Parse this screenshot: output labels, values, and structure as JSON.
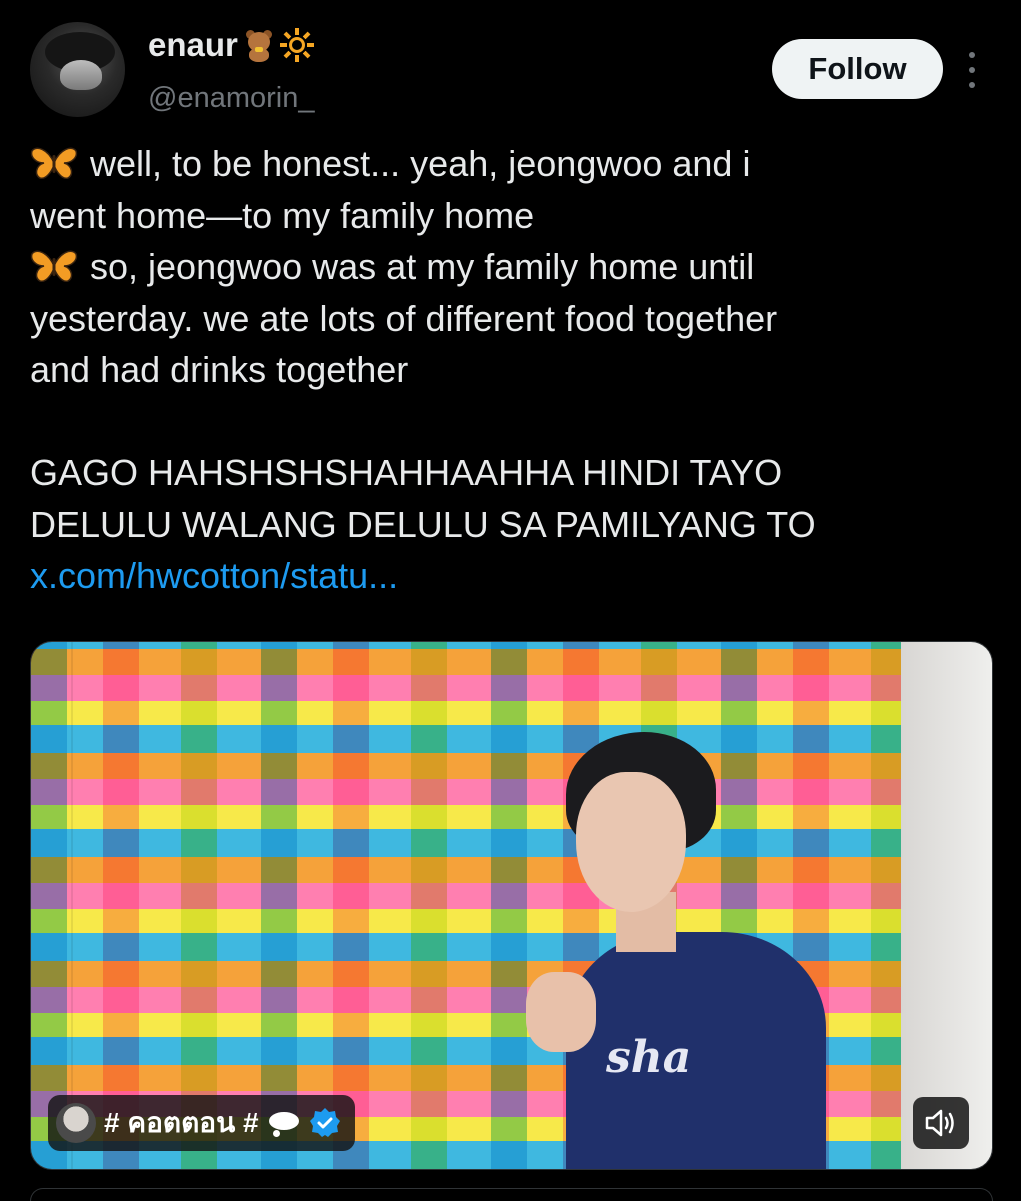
{
  "author": {
    "display_name": "enaur",
    "name_emojis": [
      "teddy-bear",
      "sun"
    ],
    "handle": "@enamorin_"
  },
  "actions": {
    "follow_label": "Follow"
  },
  "tweet": {
    "line1": "well, to be honest... yeah, jeongwoo and i",
    "line2": "went home—to my family home",
    "line3": "so, jeongwoo was at my family home until",
    "line4": "yesterday. we ate lots of different food together",
    "line5": "and had drinks together",
    "line6": "GAGO HAHSHSHSHAHHAAHHA HINDI TAYO",
    "line7": "DELULU WALANG DELULU SA PAMILYANG TO",
    "link": "x.com/hwcotton/statu..."
  },
  "media": {
    "badge_text": "# คอตตอน #",
    "shirt_text": "sha",
    "icons": [
      "thought-bubble",
      "verified-badge",
      "speaker"
    ]
  },
  "colors": {
    "background": "#000000",
    "text": "#e7e9ea",
    "muted": "#71767b",
    "link": "#1d9bf0",
    "follow_bg": "#eff3f4"
  }
}
